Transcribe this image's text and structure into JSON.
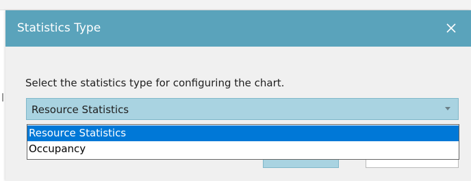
{
  "dialog": {
    "title": "Statistics Type",
    "close_icon": "close-icon",
    "instruction": "Select the statistics type for configuring the chart.",
    "statistics_select": {
      "value": "Resource Statistics",
      "arrow_icon": "chevron-down-icon",
      "options": [
        {
          "label": "Resource Statistics",
          "selected": true
        },
        {
          "label": "Occupancy",
          "selected": false
        }
      ]
    }
  },
  "colors": {
    "titlebar": "#5aa3bb",
    "combo_fill": "#a9d3e1",
    "selection": "#0078d7",
    "dialog_body": "#f0f0f0"
  }
}
